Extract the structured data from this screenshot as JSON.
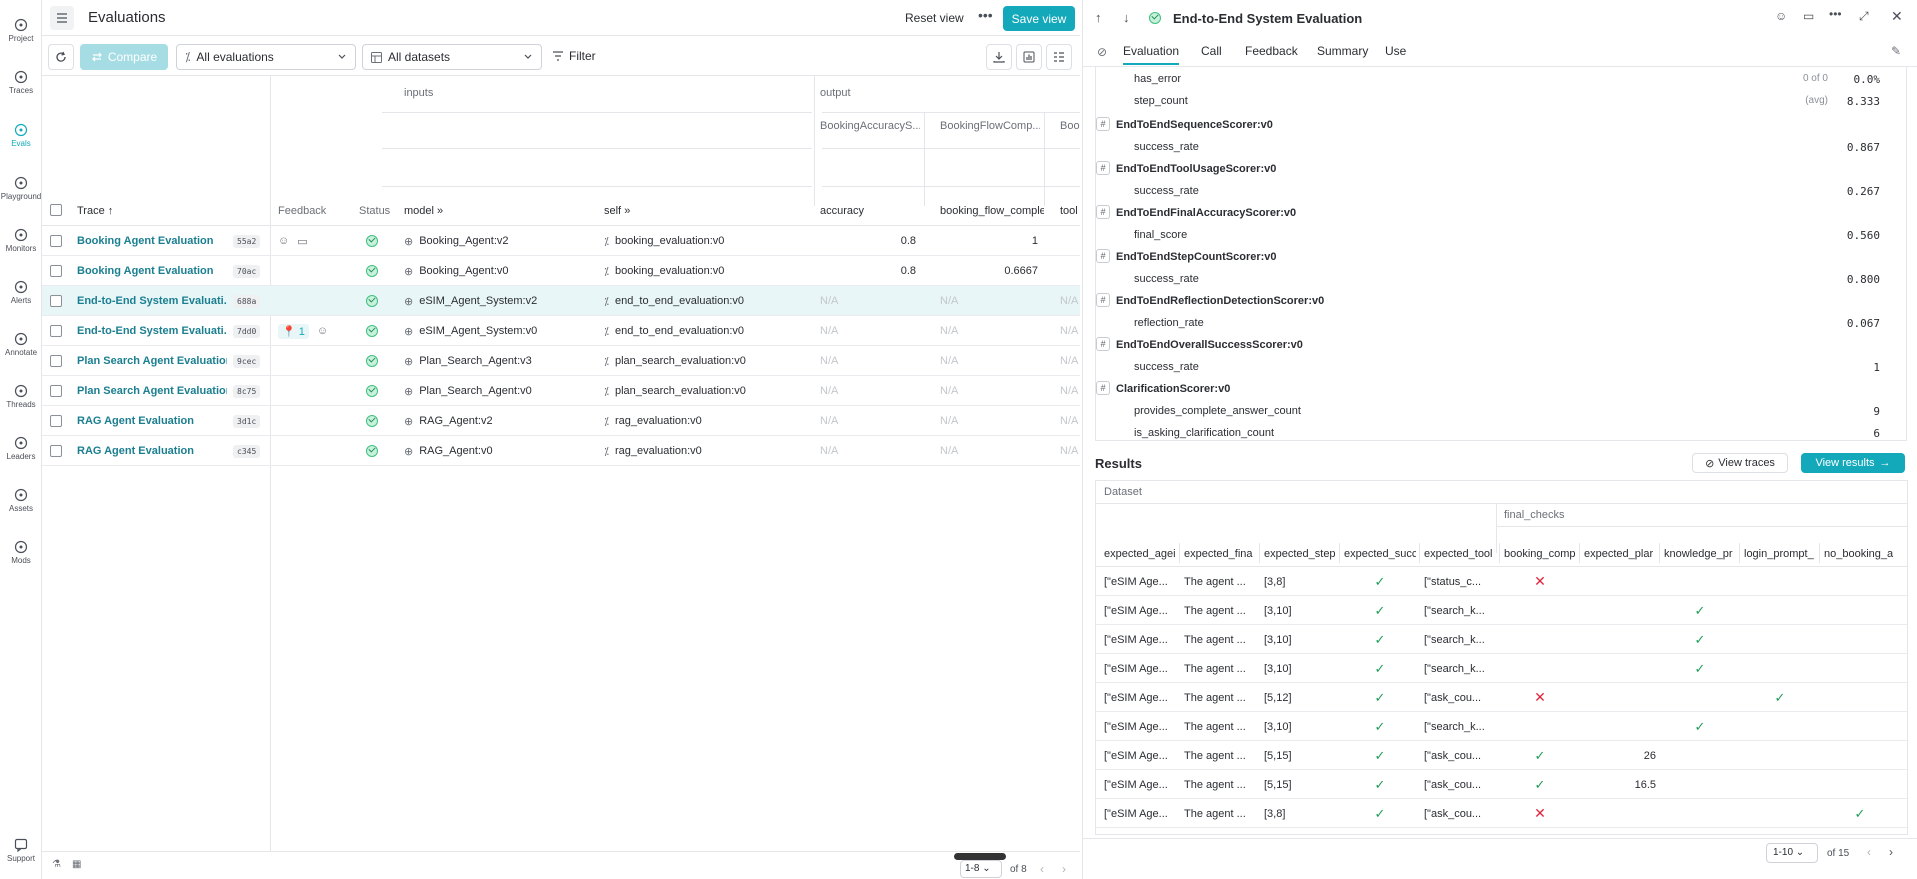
{
  "nav": [
    {
      "label": "Project",
      "icon": "project-icon"
    },
    {
      "label": "Traces",
      "icon": "traces-icon"
    },
    {
      "label": "Evals",
      "icon": "evals-icon",
      "active": true
    },
    {
      "label": "Playground",
      "icon": "playground-icon"
    },
    {
      "label": "Monitors",
      "icon": "monitors-icon"
    },
    {
      "label": "Alerts",
      "icon": "alerts-icon"
    },
    {
      "label": "Annotate",
      "icon": "annotate-icon"
    },
    {
      "label": "Threads",
      "icon": "threads-icon"
    },
    {
      "label": "Leaders",
      "icon": "leaders-icon"
    },
    {
      "label": "Assets",
      "icon": "assets-icon"
    },
    {
      "label": "Mods",
      "icon": "mods-icon"
    }
  ],
  "support_label": "Support",
  "header": {
    "title": "Evaluations",
    "reset_view": "Reset view",
    "save_view": "Save view"
  },
  "toolbar": {
    "compare": "Compare",
    "evaluations_select": "All evaluations",
    "datasets_select": "All datasets",
    "filter": "Filter"
  },
  "grid": {
    "group_inputs": "inputs",
    "group_output": "output",
    "output_sub": [
      "BookingAccuracyS...",
      "BookingFlowComp...",
      "Boo"
    ],
    "columns": {
      "trace": "Trace",
      "feedback": "Feedback",
      "status": "Status",
      "model": "model",
      "self": "self",
      "accuracy": "accuracy",
      "booking_flow": "booking_flow_comple",
      "tool": "tool"
    },
    "rows": [
      {
        "trace": "Booking Agent Evaluation",
        "hash": "55a2",
        "feedback": "icons",
        "model": "Booking_Agent:v2",
        "self": "booking_evaluation:v0",
        "accuracy": "0.8",
        "booking_flow": "1",
        "tool": ""
      },
      {
        "trace": "Booking Agent Evaluation",
        "hash": "70ac",
        "feedback": "",
        "model": "Booking_Agent:v0",
        "self": "booking_evaluation:v0",
        "accuracy": "0.8",
        "booking_flow": "0.6667",
        "tool": ""
      },
      {
        "trace": "End-to-End System Evaluati...",
        "hash": "688a",
        "feedback": "",
        "model": "eSIM_Agent_System:v2",
        "self": "end_to_end_evaluation:v0",
        "accuracy": "N/A",
        "booking_flow": "N/A",
        "tool": "N/A",
        "selected": true
      },
      {
        "trace": "End-to-End System Evaluati...",
        "hash": "7dd0",
        "feedback": "pin",
        "feedback_count": "1",
        "model": "eSIM_Agent_System:v0",
        "self": "end_to_end_evaluation:v0",
        "accuracy": "N/A",
        "booking_flow": "N/A",
        "tool": "N/A"
      },
      {
        "trace": "Plan Search Agent Evaluation",
        "hash": "9cec",
        "feedback": "",
        "model": "Plan_Search_Agent:v3",
        "self": "plan_search_evaluation:v0",
        "accuracy": "N/A",
        "booking_flow": "N/A",
        "tool": "N/A"
      },
      {
        "trace": "Plan Search Agent Evaluation",
        "hash": "8c75",
        "feedback": "",
        "model": "Plan_Search_Agent:v0",
        "self": "plan_search_evaluation:v0",
        "accuracy": "N/A",
        "booking_flow": "N/A",
        "tool": "N/A"
      },
      {
        "trace": "RAG Agent Evaluation",
        "hash": "3d1c",
        "feedback": "",
        "model": "RAG_Agent:v2",
        "self": "rag_evaluation:v0",
        "accuracy": "N/A",
        "booking_flow": "N/A",
        "tool": "N/A"
      },
      {
        "trace": "RAG Agent Evaluation",
        "hash": "c345",
        "feedback": "",
        "model": "RAG_Agent:v0",
        "self": "rag_evaluation:v0",
        "accuracy": "N/A",
        "booking_flow": "N/A",
        "tool": "N/A"
      }
    ],
    "pagination": {
      "range": "1-8",
      "of": "of 8"
    }
  },
  "panel": {
    "title": "End-to-End System Evaluation",
    "tabs": [
      "Evaluation",
      "Call",
      "Feedback",
      "Summary",
      "Use"
    ],
    "top_metrics": [
      {
        "name": "has_error",
        "extra": "0 of 0",
        "value": "0.0%"
      },
      {
        "name": "step_count",
        "extra": "(avg)",
        "value": "8.333"
      }
    ],
    "scorers": [
      {
        "name": "EndToEndSequenceScorer:v0",
        "metric": "success_rate",
        "value": "0.867"
      },
      {
        "name": "EndToEndToolUsageScorer:v0",
        "metric": "success_rate",
        "value": "0.267"
      },
      {
        "name": "EndToEndFinalAccuracyScorer:v0",
        "metric": "final_score",
        "value": "0.560"
      },
      {
        "name": "EndToEndStepCountScorer:v0",
        "metric": "success_rate",
        "value": "0.800"
      },
      {
        "name": "EndToEndReflectionDetectionScorer:v0",
        "metric": "reflection_rate",
        "value": "0.067"
      },
      {
        "name": "EndToEndOverallSuccessScorer:v0",
        "metric": "success_rate",
        "value": "1"
      }
    ],
    "clarification": {
      "name": "ClarificationScorer:v0",
      "metrics": [
        {
          "name": "provides_complete_answer_count",
          "value": "9"
        },
        {
          "name": "is_asking_clarification_count",
          "value": "6"
        }
      ]
    },
    "results": {
      "title": "Results",
      "view_traces": "View traces",
      "view_results": "View results",
      "group_dataset": "Dataset",
      "group_final_checks": "final_checks",
      "columns": [
        "expected_agei",
        "expected_fina",
        "expected_step",
        "expected_succ",
        "expected_tool",
        "booking_comp",
        "expected_plar",
        "knowledge_pr",
        "login_prompt_",
        "no_booking_a"
      ],
      "rows": [
        {
          "agent": "[\"eSIM Age...",
          "final": "The agent ...",
          "step": "[3,8]",
          "succ": "check",
          "tool": "[\"status_c...",
          "booking": "cross",
          "plan": "",
          "knowledge": "",
          "login": "",
          "nobooking": ""
        },
        {
          "agent": "[\"eSIM Age...",
          "final": "The agent ...",
          "step": "[3,10]",
          "succ": "check",
          "tool": "[\"search_k...",
          "booking": "",
          "plan": "",
          "knowledge": "check",
          "login": "",
          "nobooking": ""
        },
        {
          "agent": "[\"eSIM Age...",
          "final": "The agent ...",
          "step": "[3,10]",
          "succ": "check",
          "tool": "[\"search_k...",
          "booking": "",
          "plan": "",
          "knowledge": "check",
          "login": "",
          "nobooking": ""
        },
        {
          "agent": "[\"eSIM Age...",
          "final": "The agent ...",
          "step": "[3,10]",
          "succ": "check",
          "tool": "[\"search_k...",
          "booking": "",
          "plan": "",
          "knowledge": "check",
          "login": "",
          "nobooking": ""
        },
        {
          "agent": "[\"eSIM Age...",
          "final": "The agent ...",
          "step": "[5,12]",
          "succ": "check",
          "tool": "[\"ask_cou...",
          "booking": "cross",
          "plan": "",
          "knowledge": "",
          "login": "check",
          "nobooking": ""
        },
        {
          "agent": "[\"eSIM Age...",
          "final": "The agent ...",
          "step": "[3,10]",
          "succ": "check",
          "tool": "[\"search_k...",
          "booking": "",
          "plan": "",
          "knowledge": "check",
          "login": "",
          "nobooking": ""
        },
        {
          "agent": "[\"eSIM Age...",
          "final": "The agent ...",
          "step": "[5,15]",
          "succ": "check",
          "tool": "[\"ask_cou...",
          "booking": "check",
          "plan": "26",
          "knowledge": "",
          "login": "",
          "nobooking": ""
        },
        {
          "agent": "[\"eSIM Age...",
          "final": "The agent ...",
          "step": "[5,15]",
          "succ": "check",
          "tool": "[\"ask_cou...",
          "booking": "check",
          "plan": "16.5",
          "knowledge": "",
          "login": "",
          "nobooking": ""
        },
        {
          "agent": "[\"eSIM Age...",
          "final": "The agent ...",
          "step": "[3,8]",
          "succ": "check",
          "tool": "[\"ask_cou...",
          "booking": "cross",
          "plan": "",
          "knowledge": "",
          "login": "",
          "nobooking": "check"
        }
      ],
      "pagination": {
        "range": "1-10",
        "of": "of 15"
      }
    }
  },
  "colors": {
    "accent": "#13a9ba",
    "check": "#1f9e57",
    "cross": "#e0283d"
  }
}
